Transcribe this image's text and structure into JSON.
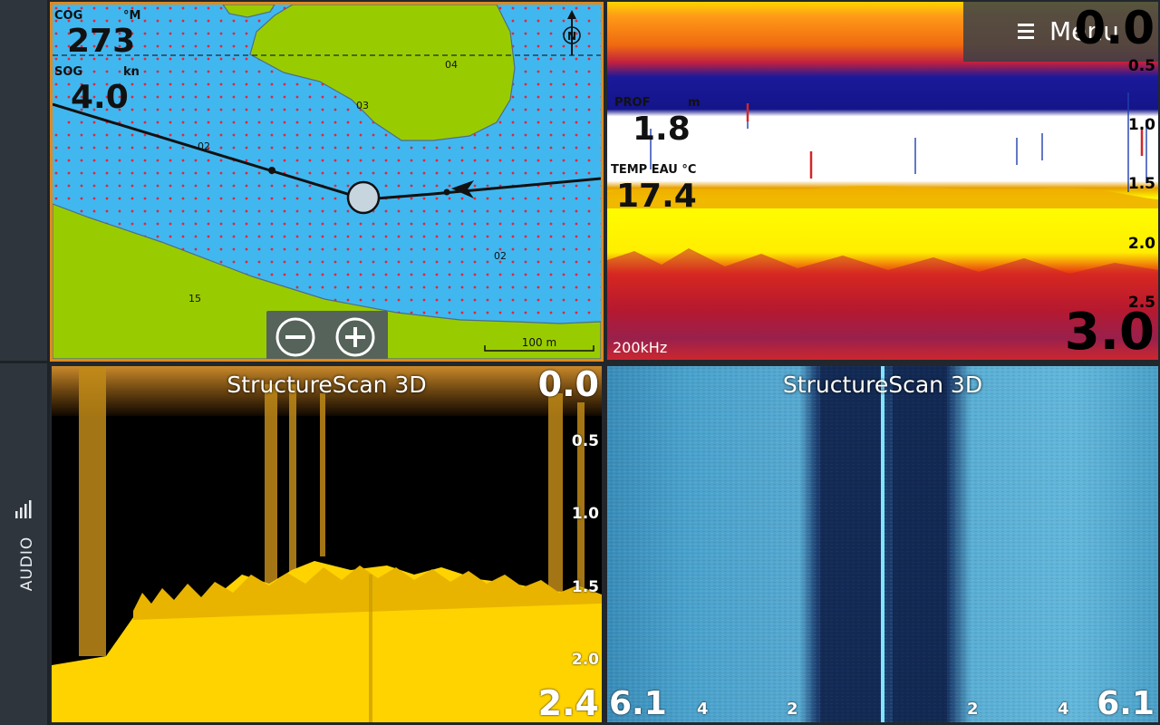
{
  "sidebar": {
    "audio_label": "AUDIO"
  },
  "chart": {
    "cog_label": "COG",
    "cog_unit": "°M",
    "cog_value": "273",
    "sog_label": "SOG",
    "sog_unit": "kn",
    "sog_value": "4.0",
    "scale_label": "100 m",
    "soundings": [
      "04",
      "03",
      "02",
      "02",
      "15"
    ],
    "north_label": "N"
  },
  "sonar": {
    "menu_label": "Menu",
    "depth_top": "0.0",
    "depth_bottom": "3.0",
    "scale": [
      "0.5",
      "1.0",
      "1.5",
      "2.0",
      "2.5"
    ],
    "depth_label": "PROF",
    "depth_unit": "m",
    "depth_value": "1.8",
    "temp_label": "TEMP EAU °C",
    "temp_value": "17.4",
    "frequency": "200kHz"
  },
  "structure_left": {
    "title": "StructureScan 3D",
    "depth_top": "0.0",
    "depth_bottom": "2.4",
    "scale": [
      "0.5",
      "1.0",
      "1.5",
      "2.0"
    ]
  },
  "structure_down": {
    "title": "StructureScan 3D",
    "range_left": "6.1",
    "range_right": "6.1",
    "ticks": [
      "4",
      "2",
      "2",
      "4"
    ]
  }
}
